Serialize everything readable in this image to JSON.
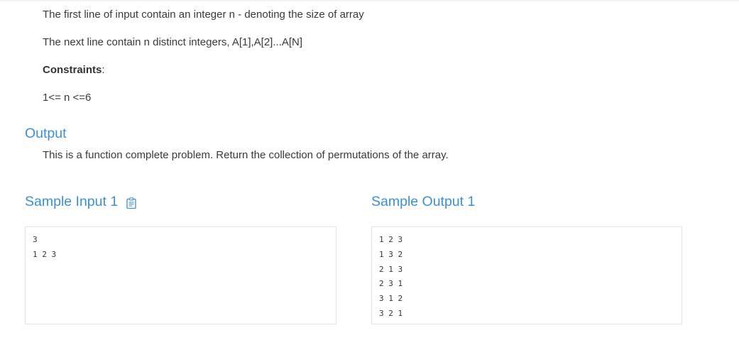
{
  "input_section": {
    "line1": "The first line of input contain an integer n - denoting the size of array",
    "line2": "The next line contain n distinct integers, A[1],A[2]...A[N]",
    "constraints_label": "Constraints",
    "constraints_colon": ":",
    "constraint": "1<= n <=6"
  },
  "output_section": {
    "title": "Output",
    "text": "This is a function complete problem. Return the collection of permutations of the array."
  },
  "sample_input": {
    "title": "Sample Input 1",
    "icon": "clipboard-icon",
    "lines": [
      "3",
      "1 2 3"
    ]
  },
  "sample_output": {
    "title": "Sample Output 1",
    "lines": [
      "1 2 3",
      "1 3 2",
      "2 1 3",
      "2 3 1",
      "3 1 2",
      "3 2 1"
    ]
  },
  "colors": {
    "heading": "#3d8fd6",
    "text": "#3a3a3a",
    "border": "#e3e3e3"
  }
}
